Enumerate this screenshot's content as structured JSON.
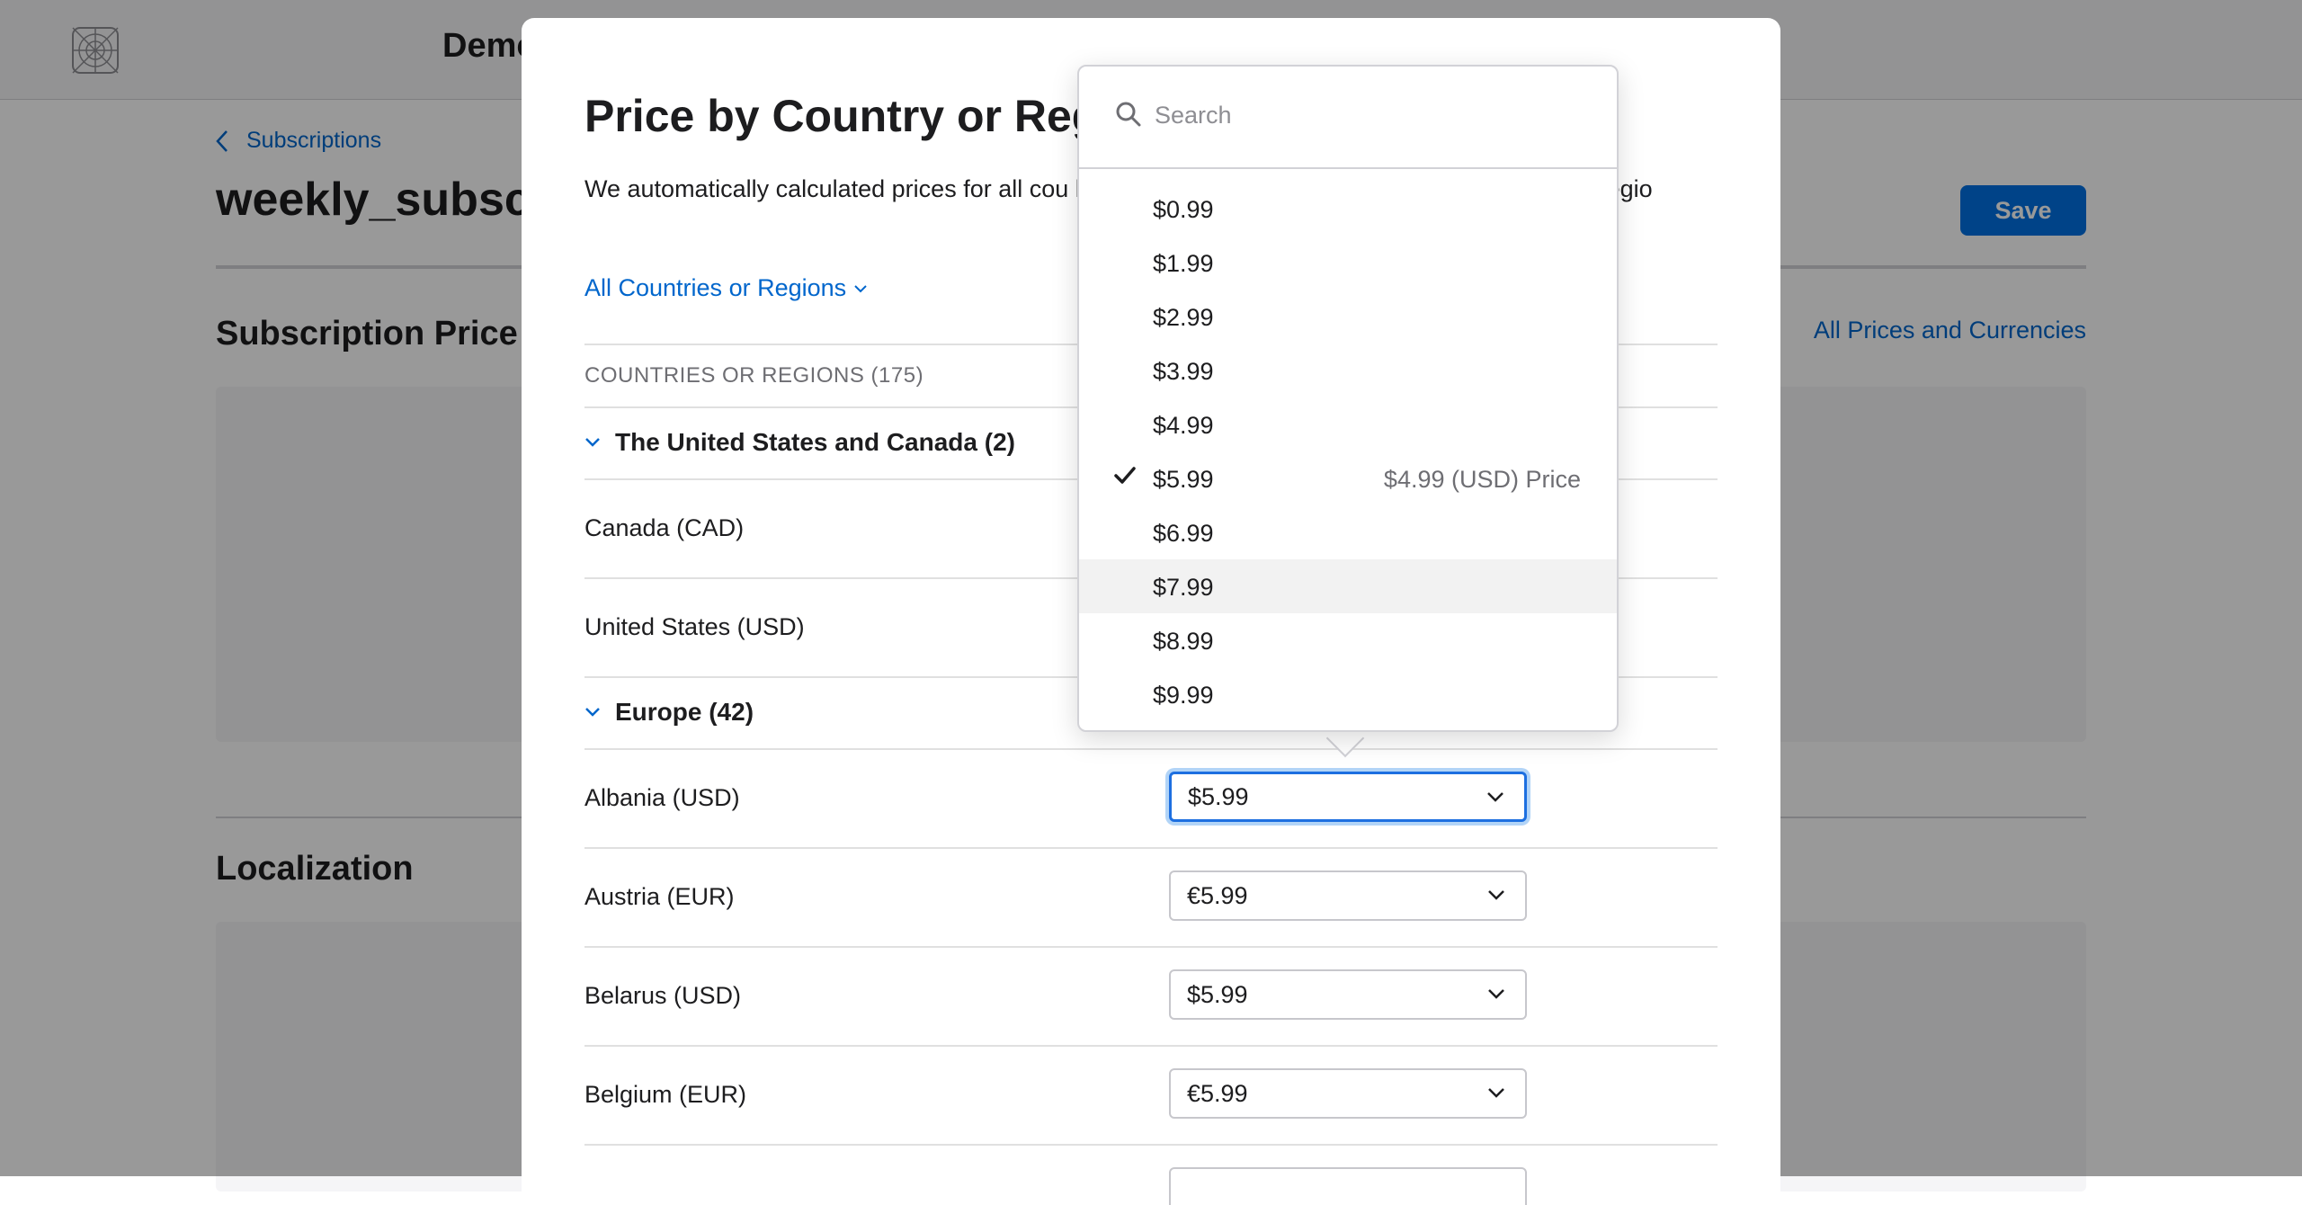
{
  "header": {
    "app_name": "Demo"
  },
  "page": {
    "back_label": "Subscriptions",
    "title": "weekly_subscri",
    "save_label": "Save",
    "section_price": "Subscription Price",
    "all_prices_link": "All Prices and Currencies",
    "section_localization": "Localization"
  },
  "modal": {
    "title": "Price by Country or Regi",
    "description": "We automatically calculated prices for all cou                                               hoose a different price for individual countries or regio",
    "filter_label": "All Countries or Regions",
    "table_header": "COUNTRIES OR REGIONS (175)",
    "groups": [
      {
        "label": "The United States and Canada (2)"
      },
      {
        "label": "Europe (42)"
      }
    ],
    "countries": [
      {
        "name": "Canada (CAD)"
      },
      {
        "name": "United States (USD)"
      },
      {
        "name": "Albania (USD)",
        "price": "$5.99"
      },
      {
        "name": "Austria (EUR)",
        "price": "€5.99"
      },
      {
        "name": "Belarus (USD)",
        "price": "$5.99"
      },
      {
        "name": "Belgium (EUR)",
        "price": "€5.99"
      }
    ]
  },
  "dropdown": {
    "search_placeholder": "Search",
    "options": [
      "$0.99",
      "$1.99",
      "$2.99",
      "$3.99",
      "$4.99",
      "$5.99",
      "$6.99",
      "$7.99",
      "$8.99",
      "$9.99"
    ],
    "selected_option": "$5.99",
    "selected_note": "$4.99 (USD) Price",
    "hovered_option": "$7.99"
  },
  "colors": {
    "accent": "#0066cc",
    "button_blue": "#0071e3",
    "focus_ring": "#1d6fe0"
  },
  "icons": [
    "app-logo-icon",
    "chevron-left-icon",
    "chevron-down-icon",
    "search-icon",
    "checkmark-icon"
  ]
}
